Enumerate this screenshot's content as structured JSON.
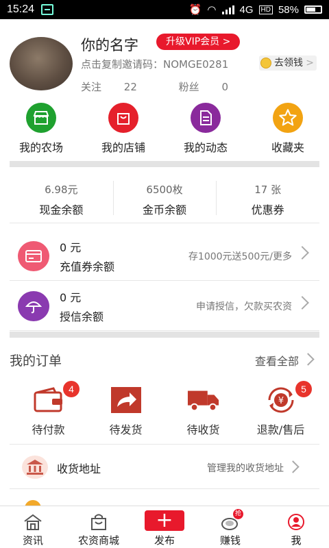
{
  "status_bar": {
    "time": "15:24",
    "network": "4G",
    "battery": "58%"
  },
  "profile": {
    "name": "你的名字",
    "vip_button": "升级VIP会员 >",
    "invite_prefix": "点击复制邀请码：",
    "invite_code": "NOMGE0281",
    "earn_button": "去领钱",
    "follow_label": "关注",
    "follow_count": "22",
    "fans_label": "粉丝",
    "fans_count": "0"
  },
  "quick_actions": [
    {
      "label": "我的农场",
      "icon": "farm-shop-icon",
      "color": "#1fa12f"
    },
    {
      "label": "我的店铺",
      "icon": "shopping-bag-icon",
      "color": "#e5202b"
    },
    {
      "label": "我的动态",
      "icon": "document-icon",
      "color": "#8a2a9c"
    },
    {
      "label": "收藏夹",
      "icon": "star-icon",
      "color": "#f2a312"
    }
  ],
  "balances": [
    {
      "value": "6.98元",
      "label": "现金余额"
    },
    {
      "value": "6500枚",
      "label": "金币余额"
    },
    {
      "value": "17 张",
      "label": "优惠券"
    }
  ],
  "recharge": {
    "amount": "0 元",
    "label": "充值券余额",
    "hint": "存1000元送500元/更多",
    "icon": "card-icon",
    "color": "#ef5a73"
  },
  "credit": {
    "amount": "0 元",
    "label": "授信余额",
    "hint": "申请授信，欠款买农资",
    "icon": "umbrella-icon",
    "color": "#8a3ab0"
  },
  "orders": {
    "title": "我的订单",
    "view_all": "查看全部",
    "items": [
      {
        "label": "待付款",
        "badge": "4",
        "icon": "wallet-icon"
      },
      {
        "label": "待发货",
        "badge": "",
        "icon": "share-arrow-icon"
      },
      {
        "label": "待收货",
        "badge": "",
        "icon": "truck-icon"
      },
      {
        "label": "退款/售后",
        "badge": "5",
        "icon": "refund-yen-icon"
      }
    ]
  },
  "address": {
    "label": "收货地址",
    "hint": "管理我的收货地址",
    "icon": "bank-building-icon"
  },
  "bottom_nav": [
    {
      "label": "资讯",
      "icon": "home-news-icon"
    },
    {
      "label": "农资商城",
      "icon": "shopping-bag-icon"
    },
    {
      "label": "发布",
      "icon": "plus-icon"
    },
    {
      "label": "赚钱",
      "icon": "coin-grab-icon",
      "tag": "抢"
    },
    {
      "label": "我",
      "icon": "user-icon",
      "active": true
    }
  ],
  "colors": {
    "brand_red": "#e8192c",
    "divider": "#e3e3e3"
  }
}
